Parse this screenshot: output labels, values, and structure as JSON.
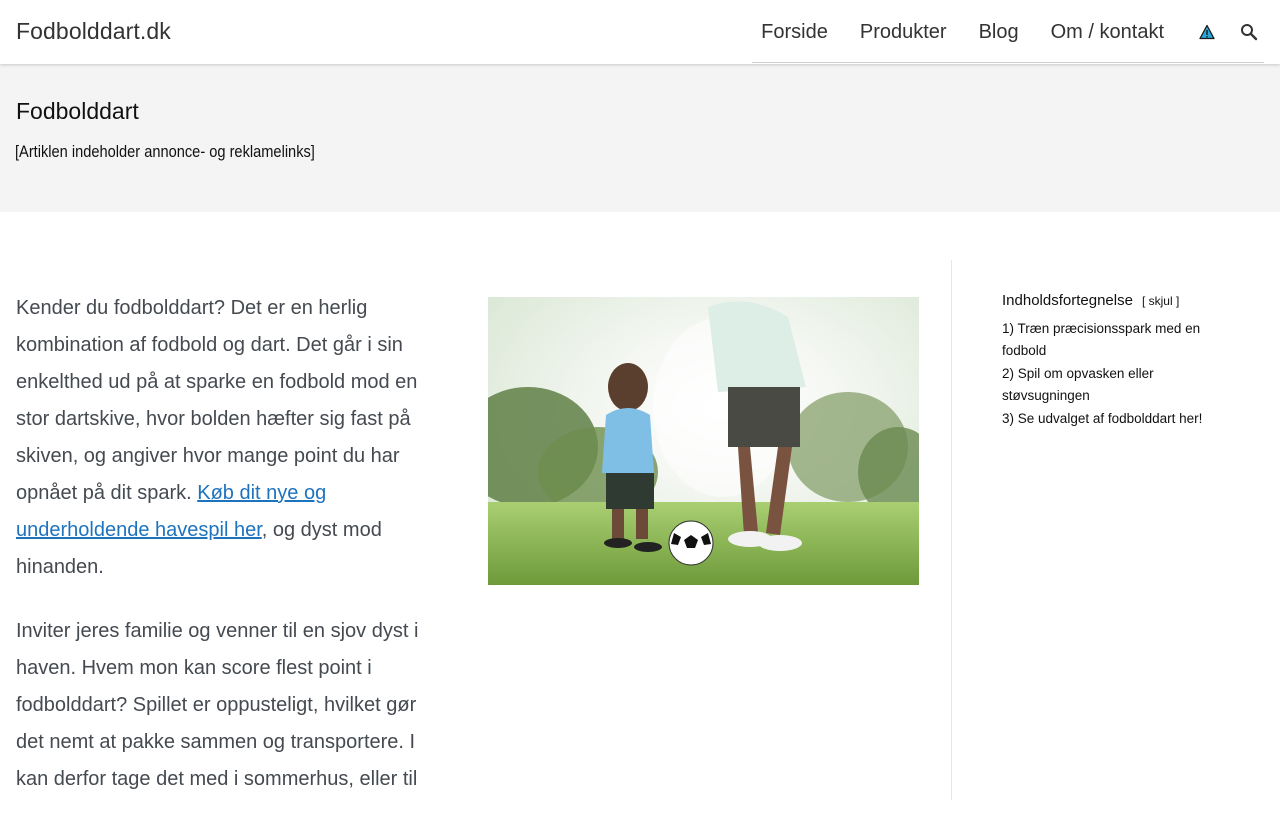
{
  "header": {
    "brand": "Fodbolddart.dk",
    "nav": [
      {
        "label": "Forside"
      },
      {
        "label": "Produkter"
      },
      {
        "label": "Blog"
      },
      {
        "label": "Om / kontakt"
      }
    ],
    "icons": {
      "warning": "warning-triangle-icon",
      "search": "search-icon"
    }
  },
  "hero": {
    "title": "Fodbolddart",
    "disclaimer": "[Artiklen indeholder annonce- og reklamelinks]"
  },
  "article": {
    "para1_before": "Kender du fodbolddart? Det er en herlig kombination af fodbold og dart. Det går i sin enkelthed ud på at sparke en fodbold mod en stor dartskive, hvor bolden hæfter sig fast på skiven, og angiver hvor mange point du har opnået på dit spark. ",
    "para1_link": "Køb dit nye og underholdende havespil her",
    "para1_after": ", og dyst mod hinanden.",
    "para2": "Inviter jeres familie og venner til en sjov dyst i haven. Hvem mon kan score flest point i fodbolddart? Spillet er oppusteligt, hvilket gør det nemt at pakke sammen og transportere. I kan derfor tage det med i sommerhus, eller til"
  },
  "toc": {
    "title": "Indholdsfortegnelse",
    "toggle_open": "[",
    "toggle_label": "skjul",
    "toggle_close": "]",
    "items": [
      {
        "num": "1)",
        "label": "Træn præcisionsspark med en fodbold"
      },
      {
        "num": "2)",
        "label": "Spil om opvasken eller støvsugningen"
      },
      {
        "num": "3)",
        "label": "Se udvalget af fodbolddart her!"
      }
    ]
  },
  "colors": {
    "link": "#1e73be",
    "hero_bg": "#f4f4f4",
    "warning_fill": "#2aa7d8"
  }
}
